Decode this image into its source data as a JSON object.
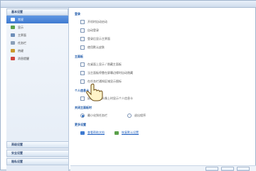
{
  "sidebar": {
    "header": "基本设置",
    "items": [
      {
        "label": "常规",
        "icon": "settings-icon",
        "color": "#3f7ad0",
        "active": true
      },
      {
        "label": "显示",
        "icon": "display-icon",
        "color": "#5aa04a",
        "active": false
      },
      {
        "label": "主界面",
        "icon": "window-icon",
        "color": "#6f8fb9",
        "active": false
      },
      {
        "label": "任务栏",
        "icon": "taskbar-icon",
        "color": "#8a9fb8",
        "active": false
      },
      {
        "label": "热键",
        "icon": "keyboard-icon",
        "color": "#c99a2e",
        "active": false
      },
      {
        "label": "消息提醒",
        "icon": "message-icon",
        "color": "#d0443c",
        "active": false
      }
    ],
    "bottom_groups": [
      "高级设置",
      "安全设置",
      "隐私设置"
    ]
  },
  "main": {
    "section_login": "登录",
    "login_options": [
      {
        "label": "开机时自动启动",
        "checked": false
      },
      {
        "label": "自动登录",
        "checked": false
      },
      {
        "label": "登录后显示主界面",
        "checked": false
      },
      {
        "label": "使用默认皮肤",
        "checked": false
      }
    ],
    "section_panel": "主面板",
    "panel_options": [
      {
        "label": "在桌面上显示 / 隐藏主面板",
        "checked": false
      },
      {
        "label": "当主面板停靠在屏幕边缘时自动隐藏",
        "checked": false
      },
      {
        "label": "在任务栏通知区域显示图标",
        "checked": false
      }
    ],
    "section_shortcut": "个人信息卡",
    "shortcut_options": [
      {
        "label": "鼠标悬停在头像上时显示个人信息卡",
        "checked": false
      }
    ],
    "section_close": "关闭主面板时",
    "close_options": [
      {
        "label": "最小化到任务栏",
        "selected": true
      },
      {
        "label": "退出程序",
        "selected": false
      }
    ],
    "section_links": "更多设置",
    "links": [
      "查看帮助文档",
      "恢复默认设置"
    ]
  },
  "hand_cursor_icon": "hand-pointer-icon"
}
